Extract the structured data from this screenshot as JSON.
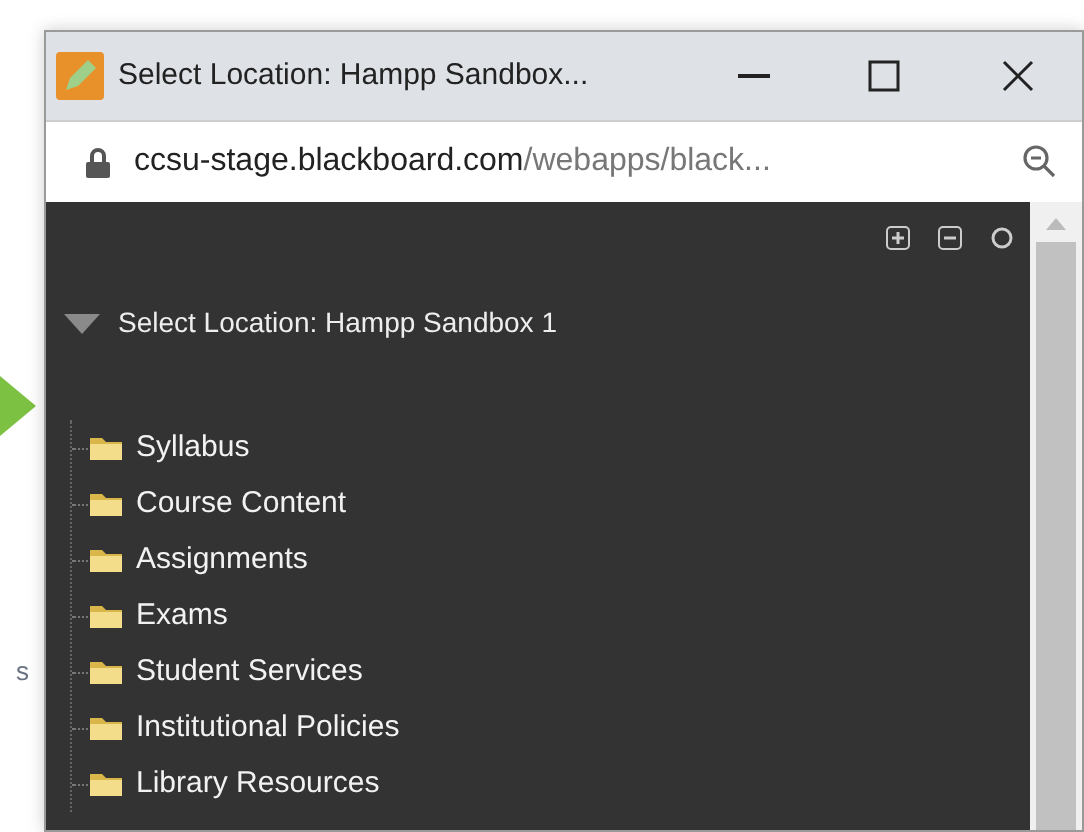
{
  "background_fragment": "s",
  "window": {
    "title": "Select Location: Hampp Sandbox..."
  },
  "address_bar": {
    "host": "ccsu-stage.blackboard.com",
    "path": "/webapps/black..."
  },
  "tree": {
    "label": "Select Location: Hampp Sandbox 1",
    "expanded": true,
    "children": [
      {
        "label": "Syllabus"
      },
      {
        "label": "Course Content"
      },
      {
        "label": "Assignments"
      },
      {
        "label": "Exams"
      },
      {
        "label": "Student Services"
      },
      {
        "label": "Institutional Policies"
      },
      {
        "label": "Library Resources"
      }
    ]
  }
}
